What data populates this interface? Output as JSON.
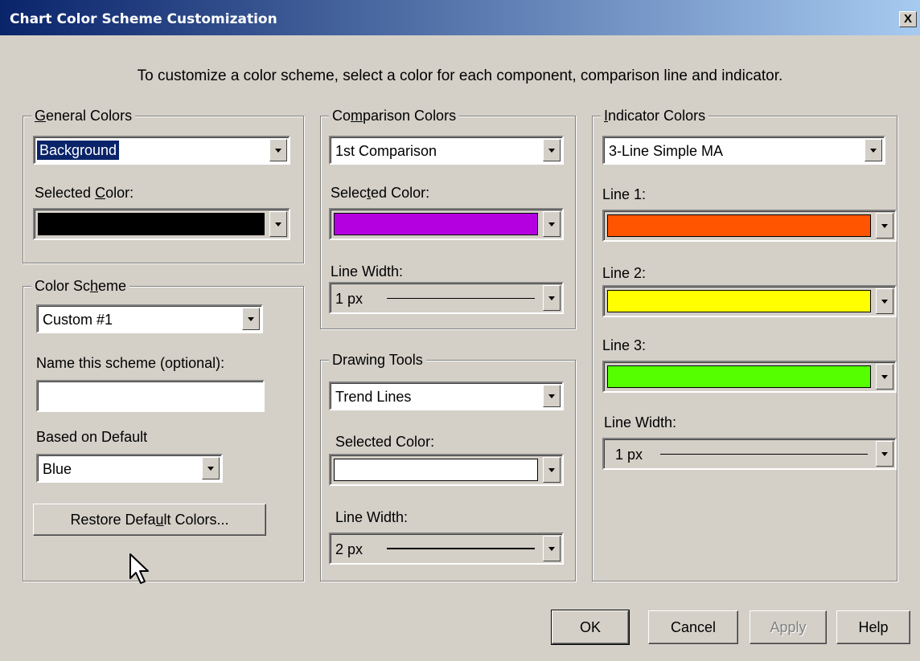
{
  "window": {
    "title": "Chart Color Scheme Customization",
    "close_glyph": "X",
    "instruction": "To customize a color scheme, select a color for each component, comparison line and indicator."
  },
  "general_colors": {
    "legend": "General Colors",
    "component_value": "Background",
    "selected_color_label": "Selected Color:",
    "selected_color": "#000000"
  },
  "color_scheme": {
    "legend": "Color Scheme",
    "scheme_value": "Custom #1",
    "name_label": "Name this scheme (optional):",
    "name_value": "",
    "based_on_label": "Based on Default",
    "based_on_value": "Blue",
    "restore_button": "Restore Default Colors..."
  },
  "comparison_colors": {
    "legend": "Comparison Colors",
    "comparison_value": "1st Comparison",
    "selected_color_label": "Selected Color:",
    "selected_color": "#b400e0",
    "line_width_label": "Line Width:",
    "line_width_value": "1 px"
  },
  "drawing_tools": {
    "legend": "Drawing Tools",
    "tool_value": "Trend Lines",
    "selected_color_label": "Selected Color:",
    "selected_color": "#ffffff",
    "line_width_label": "Line Width:",
    "line_width_value": "2 px"
  },
  "indicator_colors": {
    "legend": "Indicator Colors",
    "indicator_value": "3-Line Simple MA",
    "line1_label": "Line 1:",
    "line1_color": "#ff5500",
    "line2_label": "Line 2:",
    "line2_color": "#ffff00",
    "line3_label": "Line 3:",
    "line3_color": "#55ff00",
    "line_width_label": "Line Width:",
    "line_width_value": "1 px"
  },
  "buttons": {
    "ok": "OK",
    "cancel": "Cancel",
    "apply": "Apply",
    "help": "Help"
  },
  "icons": {
    "cursor": "mouse-pointer-icon",
    "dropdown": "chevron-down-icon"
  }
}
